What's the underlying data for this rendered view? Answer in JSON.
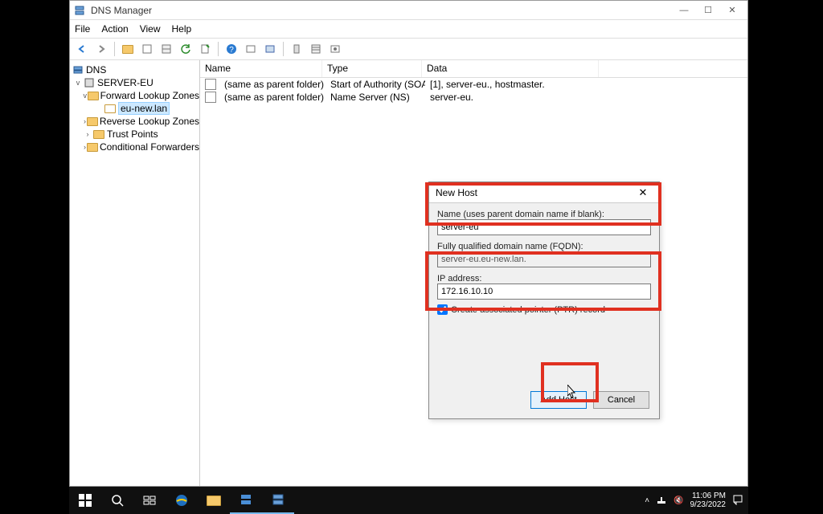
{
  "window": {
    "title": "DNS Manager",
    "menus": [
      "File",
      "Action",
      "View",
      "Help"
    ],
    "winbuttons": {
      "min": "—",
      "max": "☐",
      "close": "✕"
    }
  },
  "tree": {
    "root": "DNS",
    "server": "SERVER-EU",
    "flz": "Forward Lookup Zones",
    "zone": "eu-new.lan",
    "rlz": "Reverse Lookup Zones",
    "tp": "Trust Points",
    "cf": "Conditional Forwarders"
  },
  "columns": {
    "name": "Name",
    "type": "Type",
    "data": "Data"
  },
  "col_w": {
    "name": 152,
    "type": 124,
    "data": 220
  },
  "records": [
    {
      "name": "(same as parent folder)",
      "type": "Start of Authority (SOA)",
      "data": "[1], server-eu., hostmaster."
    },
    {
      "name": "(same as parent folder)",
      "type": "Name Server (NS)",
      "data": "server-eu."
    }
  ],
  "dialog": {
    "title": "New Host",
    "name_label": "Name (uses parent domain name if blank):",
    "name_value": "server-eu",
    "fqdn_label": "Fully qualified domain name (FQDN):",
    "fqdn_value": "server-eu.eu-new.lan.",
    "ip_label": "IP address:",
    "ip_value": "172.16.10.10",
    "ptr_label": "Create associated pointer (PTR) record",
    "ptr_checked": true,
    "addhost": "Add Host",
    "cancel": "Cancel",
    "close": "✕"
  },
  "taskbar": {
    "time": "11:06 PM",
    "date": "9/23/2022"
  }
}
